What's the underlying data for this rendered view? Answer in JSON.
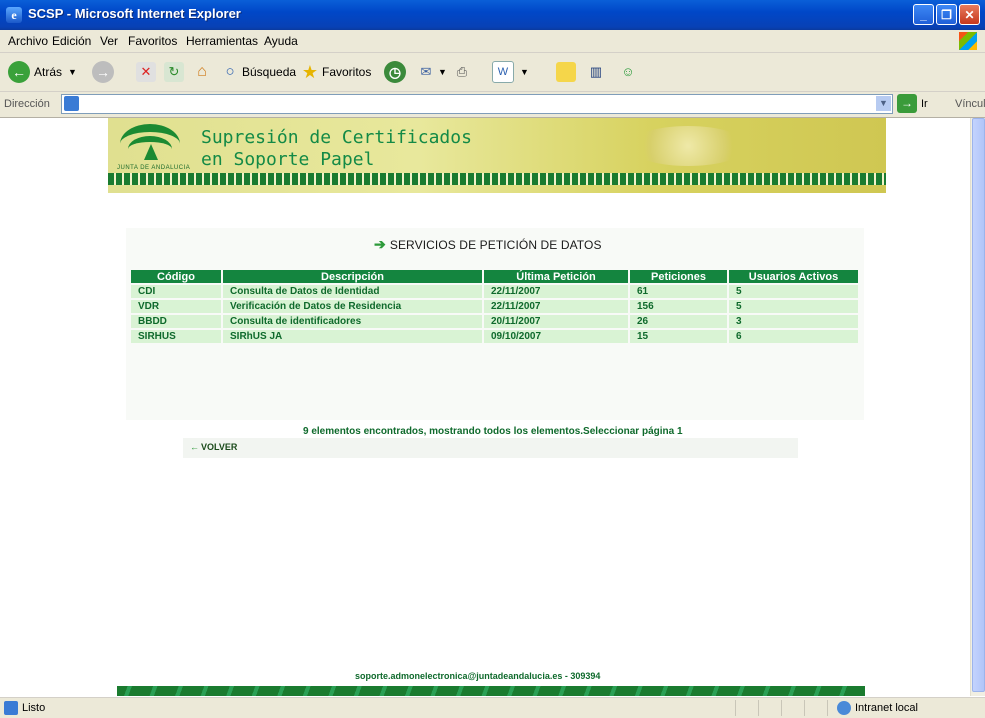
{
  "window": {
    "title": "SCSP - Microsoft Internet Explorer"
  },
  "menu": [
    "Archivo",
    "Edición",
    "Ver",
    "Favoritos",
    "Herramientas",
    "Ayuda"
  ],
  "toolbar": {
    "back": "Atrás",
    "search": "Búsqueda",
    "favorites": "Favoritos"
  },
  "address": {
    "label": "Dirección",
    "go": "Ir",
    "links": "Vínculos"
  },
  "banner": {
    "line1": "Supresión de Certificados",
    "line2": "en Soporte Papel",
    "logo_text": "JUNTA DE ANDALUCIA"
  },
  "page": {
    "heading": "SERVICIOS DE PETICIÓN DE DATOS",
    "columns": [
      "Código",
      "Descripción",
      "Última Petición",
      "Peticiones",
      "Usuarios Activos"
    ],
    "rows": [
      [
        "CDI",
        "Consulta de Datos de Identidad",
        "22/11/2007",
        "61",
        "5"
      ],
      [
        "VDR",
        "Verificación de Datos de Residencia",
        "22/11/2007",
        "156",
        "5"
      ],
      [
        "BBDD",
        "Consulta de identificadores",
        "20/11/2007",
        "26",
        "3"
      ],
      [
        "SIRHUS",
        "SIRhUS JA",
        "09/10/2007",
        "15",
        "6"
      ]
    ],
    "found_text": "9 elementos encontrados, mostrando todos los elementos.Seleccionar página 1",
    "back_label": "VOLVER",
    "footer": "soporte.admonelectronica@juntadeandalucia.es - 309394"
  },
  "status": {
    "text": "Listo",
    "zone": "Intranet local"
  }
}
